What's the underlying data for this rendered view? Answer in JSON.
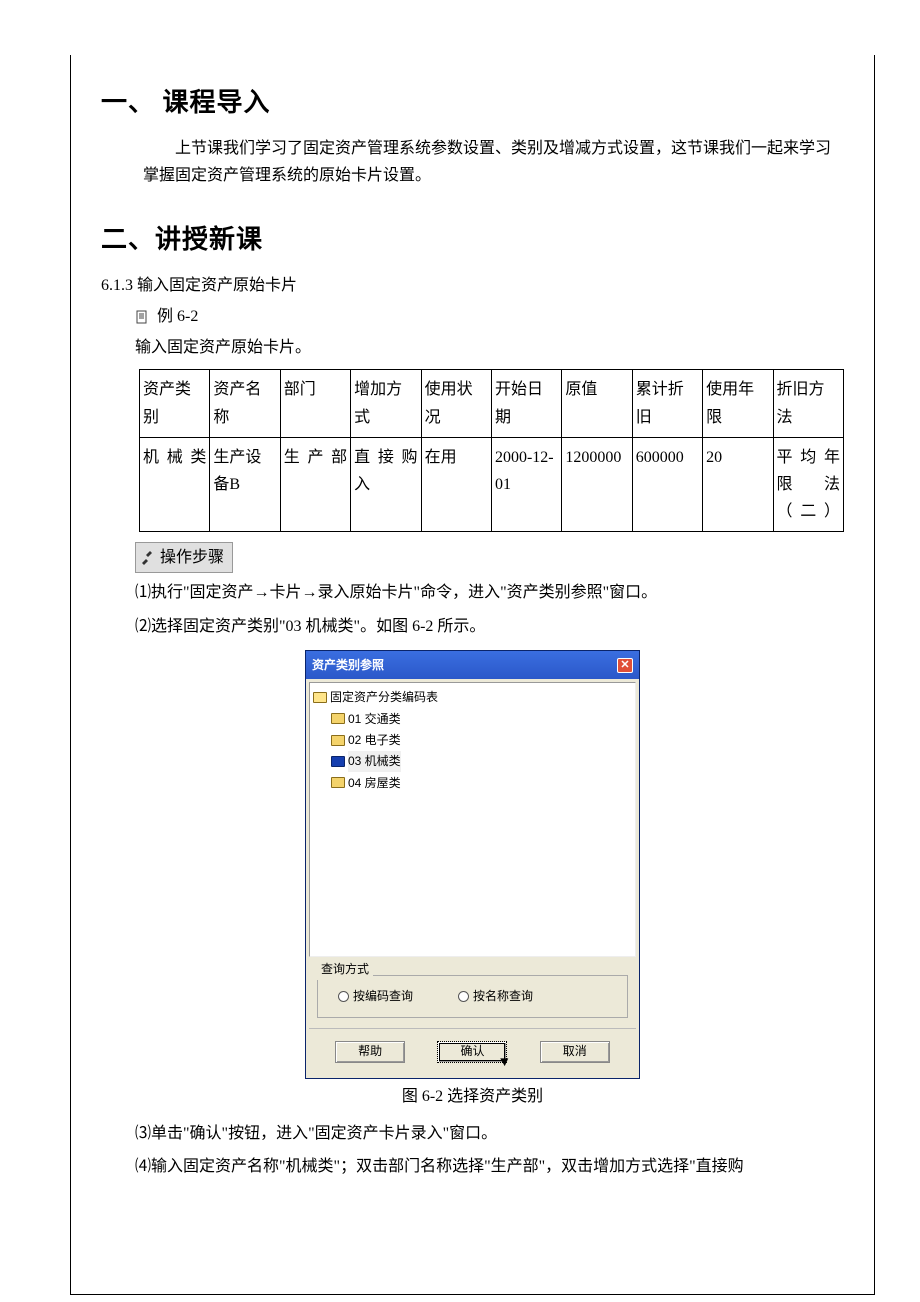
{
  "section1": {
    "title": "一、 课程导入",
    "intro": "上节课我们学习了固定资产管理系统参数设置、类别及增减方式设置，这节课我们一起来学习掌握固定资产管理系统的原始卡片设置。"
  },
  "section2": {
    "title": "二、讲授新课",
    "subsection": "6.1.3 输入固定资产原始卡片",
    "example_label": "例 6-2",
    "example_desc": "输入固定资产原始卡片。",
    "table": {
      "headers": [
        "资产类别",
        "资产名称",
        "部门",
        "增加方式",
        "使用状况",
        "开始日期",
        "原值",
        "累计折旧",
        "使用年限",
        "折旧方法"
      ],
      "row": [
        "机械类",
        "生产设备B",
        "生产部",
        "直接购入",
        "在用",
        "2000-12-01",
        "1200000",
        "600000",
        "20",
        "平均年限法（二）"
      ]
    },
    "steps_header": "操作步骤",
    "step1": "⑴执行\"固定资产→卡片→录入原始卡片\"命令，进入\"资产类别参照\"窗口。",
    "step2": "⑵选择固定资产类别\"03 机械类\"。如图 6-2 所示。",
    "figure_caption": "图 6-2 选择资产类别",
    "step3": "⑶单击\"确认\"按钮，进入\"固定资产卡片录入\"窗口。",
    "step4": "⑷输入固定资产名称\"机械类\"；双击部门名称选择\"生产部\"，双击增加方式选择\"直接购"
  },
  "dialog": {
    "title": "资产类别参照",
    "root": "固定资产分类编码表",
    "items": [
      {
        "label": "01 交通类"
      },
      {
        "label": "02 电子类"
      },
      {
        "label": "03 机械类"
      },
      {
        "label": "04 房屋类"
      }
    ],
    "query_legend": "查询方式",
    "radio_code": "按编码查询",
    "radio_name": "按名称查询",
    "btn_help": "帮助",
    "btn_ok": "确认",
    "btn_cancel": "取消"
  }
}
